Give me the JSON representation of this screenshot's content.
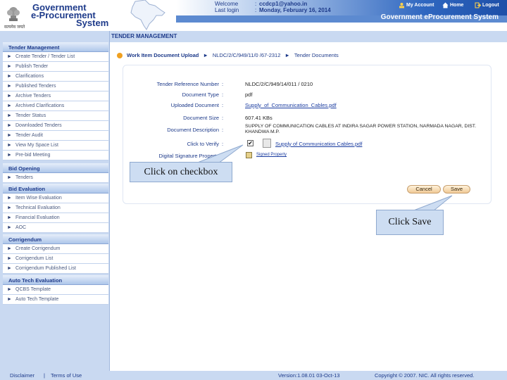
{
  "header": {
    "logo_line1": "Government",
    "logo_line2": "e-Procurement",
    "logo_line3": "System",
    "emblem_text": "सत्यमेव जयते",
    "welcome_label": "Welcome",
    "welcome_value": "ccdcp1@yahoo.in",
    "lastlogin_label": "Last login",
    "lastlogin_value": "Monday, February 16, 2014",
    "links": {
      "account": "My Account",
      "home": "Home",
      "logout": "Logout"
    },
    "system_title": "Government eProcurement System"
  },
  "section_title": "TENDER MANAGEMENT",
  "sidebar": {
    "groups": [
      {
        "title": "Tender Management",
        "items": [
          "Create Tender / Tender List",
          "Publish Tender",
          "Clarifications",
          "Published Tenders",
          "Archive Tenders",
          "Archived Clarifications",
          "Tender Status",
          "Downloaded Tenders",
          "Tender Audit",
          "View My Space List",
          "Pre-bid Meeting"
        ]
      },
      {
        "title": "Bid Opening",
        "items": [
          "Tenders"
        ]
      },
      {
        "title": "Bid Evaluation",
        "items": [
          "Item Wise Evaluation",
          "Technical Evaluation",
          "Financial Evaluation",
          "AOC"
        ]
      },
      {
        "title": "Corrigendum",
        "items": [
          "Create Corrigendum",
          "Corrigendum List",
          "Corrigendum Published List"
        ]
      },
      {
        "title": "Auto Tech Evaluation",
        "items": [
          "QCBS Template",
          "Auto Tech Template"
        ]
      }
    ]
  },
  "breadcrumb": {
    "first": "Work Item Document Upload",
    "second": "NLDC/2/C/949/11/0 /67-2312",
    "third": "Tender Documents"
  },
  "form": {
    "rows": [
      {
        "label": "Tender Reference Number",
        "value": "NLDC/2/C/949/14/011 / 0210"
      },
      {
        "label": "Document Type",
        "value": "pdf"
      },
      {
        "label": "Uploaded Document",
        "value": "Supply_of_Communication_Cables.pdf"
      },
      {
        "label": "Document Size",
        "value": "607.41 KBs"
      },
      {
        "label": "Document Description",
        "value": "SUPPLY OF COMMUNICATION CABLES AT INDIRA SAGAR POWER STATION, NARMADA NAGAR, DIST. KHANDWA M.P."
      },
      {
        "label": "Click to Verify",
        "value": "Supply of Communication Cables.pdf"
      },
      {
        "label": "Digital Signature Property",
        "value": "Signed Property"
      }
    ],
    "checkbox_mark": "✔"
  },
  "buttons": {
    "cancel": "Cancel",
    "save": "Save"
  },
  "callouts": {
    "checkbox": "Click on checkbox",
    "save": "Click Save"
  },
  "footer": {
    "disclaimer": "Disclaimer",
    "terms": "Terms of Use",
    "version": "Version:1.08.01 03-Oct-13",
    "copyright": "Copyright © 2007. NIC. All rights reserved."
  },
  "colors": {
    "accent": "#1d3a8a",
    "band": "#c9d9f1",
    "button": "#f0c995"
  }
}
